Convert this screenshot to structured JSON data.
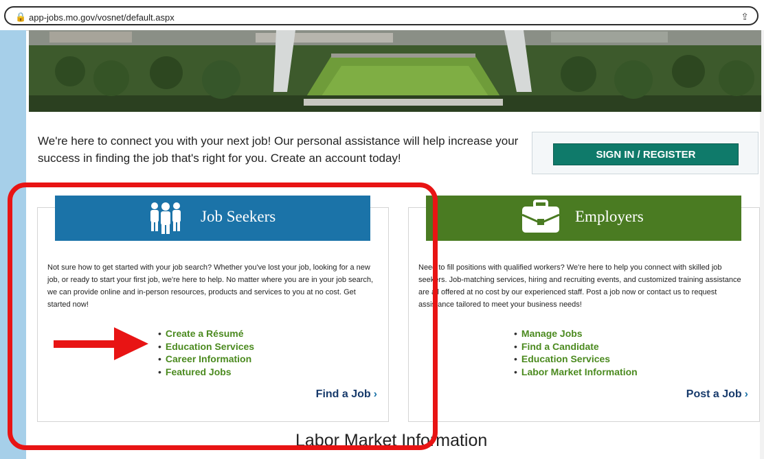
{
  "browser": {
    "url": "app-jobs.mo.gov/vosnet/default.aspx",
    "lock_icon": "lock-icon",
    "share_icon": "share-icon"
  },
  "intro": {
    "text": "We're here to connect you with your next job! Our personal assistance will help increase your success in finding the job that's right for you. Create an account today!"
  },
  "signin": {
    "label": "SIGN IN / REGISTER"
  },
  "job_seekers": {
    "title": "Job Seekers",
    "icon": "people-icon",
    "description": "Not sure how to get started with your job search? Whether you've lost your job, looking for a new job, or ready to start your first job, we're here to help. No matter where you are in your job search, we can provide online and in-person resources, products and services to you at no cost. Get started now!",
    "links": [
      "Create a Résumé",
      "Education Services",
      "Career Information",
      "Featured Jobs"
    ],
    "cta": "Find a Job"
  },
  "employers": {
    "title": "Employers",
    "icon": "briefcase-icon",
    "description": "Need to fill positions with qualified workers? We're here to help you connect with skilled job seekers. Job-matching services, hiring and recruiting events, and customized training assistance are all offered at no cost by our experienced staff. Post a job now or contact us to request assistance tailored to meet your business needs!",
    "links": [
      "Manage Jobs",
      "Find a Candidate",
      "Education Services",
      "Labor Market Information"
    ],
    "cta": "Post a Job"
  },
  "section_heading": "Labor Market Information",
  "colors": {
    "seekers_banner": "#1b73a8",
    "employers_banner": "#4a7b22",
    "signin_button": "#0f7a6a",
    "link_green": "#4b8a1f",
    "annotation_red": "#e81414"
  }
}
